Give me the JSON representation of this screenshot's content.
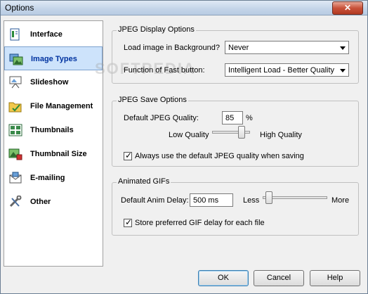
{
  "window": {
    "title": "Options",
    "close_glyph": "✕"
  },
  "watermark": "SOFTPEDIA",
  "sidebar": {
    "items": [
      {
        "label": "Interface",
        "icon": "interface-icon"
      },
      {
        "label": "Image Types",
        "icon": "image-types-icon",
        "selected": true
      },
      {
        "label": "Slideshow",
        "icon": "slideshow-icon"
      },
      {
        "label": "File Management",
        "icon": "file-management-icon"
      },
      {
        "label": "Thumbnails",
        "icon": "thumbnails-icon"
      },
      {
        "label": "Thumbnail Size",
        "icon": "thumbnail-size-icon"
      },
      {
        "label": "E-mailing",
        "icon": "e-mailing-icon"
      },
      {
        "label": "Other",
        "icon": "other-icon"
      }
    ]
  },
  "jpeg_display": {
    "legend": "JPEG Display Options",
    "load_bg_label": "Load image in Background?",
    "load_bg_value": "Never",
    "fast_button_label": "Function of Fast button:",
    "fast_button_value": "Intelligent Load - Better Quality"
  },
  "jpeg_save": {
    "legend": "JPEG Save Options",
    "quality_label": "Default JPEG Quality:",
    "quality_value": "85",
    "quality_unit": "%",
    "low_label": "Low Quality",
    "high_label": "High Quality",
    "quality_slider_fraction": 0.85,
    "always_default_label": "Always use the default JPEG quality when saving",
    "always_default_checked": true
  },
  "animated_gifs": {
    "legend": "Animated GIFs",
    "delay_label": "Default Anim Delay:",
    "delay_value": "500 ms",
    "less_label": "Less",
    "more_label": "More",
    "delay_slider_fraction": 0.05,
    "store_delay_label": "Store preferred GIF delay for each file",
    "store_delay_checked": true
  },
  "buttons": {
    "ok": "OK",
    "cancel": "Cancel",
    "help": "Help"
  },
  "check_glyph": "✓"
}
